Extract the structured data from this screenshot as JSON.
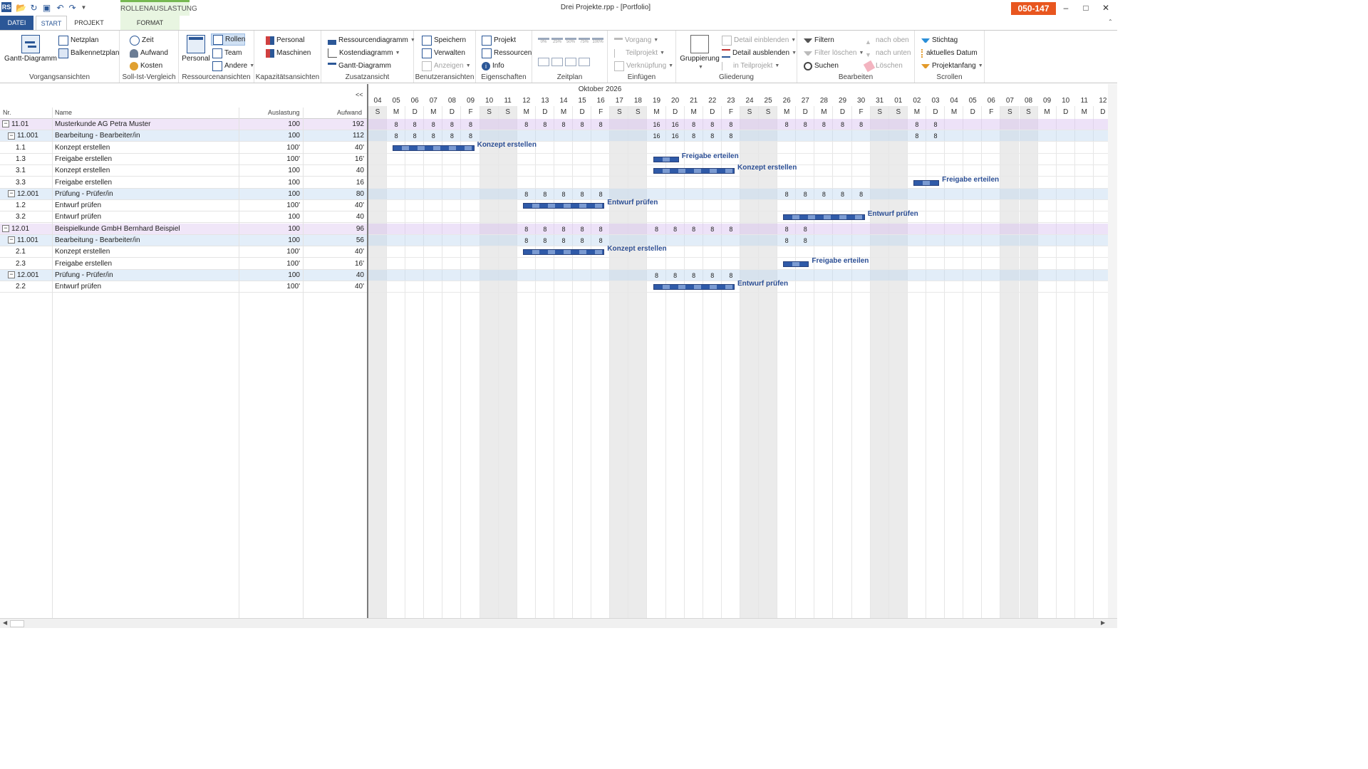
{
  "window": {
    "title": "Drei Projekte.rpp - [Portfolio]",
    "code_badge": "050-147",
    "context_tab_group": "ROLLENAUSLASTUNG",
    "app_logo": "RS"
  },
  "tabs": [
    "DATEI",
    "START",
    "PROJEKT",
    "FORMAT"
  ],
  "ribbon": {
    "vorgangsansichten": {
      "label": "Vorgangsansichten",
      "gantt": "Gantt-Diagramm",
      "netzplan": "Netzplan",
      "balkennetzplan": "Balkennetzplan"
    },
    "sollist": {
      "label": "Soll-Ist-Vergleich",
      "zeit": "Zeit",
      "aufwand": "Aufwand",
      "kosten": "Kosten"
    },
    "ressourcenansichten": {
      "label": "Ressourcenansichten",
      "personal": "Personal",
      "rollen": "Rollen",
      "team": "Team",
      "andere": "Andere"
    },
    "kapazitaet": {
      "label": "Kapazitätsansichten",
      "personal": "Personal",
      "maschinen": "Maschinen"
    },
    "zusatzansicht": {
      "label": "Zusatzansicht",
      "ressourcendiagramm": "Ressourcendiagramm",
      "kostendiagramm": "Kostendiagramm",
      "gantt": "Gantt-Diagramm"
    },
    "benutzeransichten": {
      "label": "Benutzeransichten",
      "speichern": "Speichern",
      "verwalten": "Verwalten",
      "anzeigen": "Anzeigen"
    },
    "eigenschaften": {
      "label": "Eigenschaften",
      "projekt": "Projekt",
      "ressourcen": "Ressourcen",
      "info": "Info"
    },
    "zeitplan": {
      "label": "Zeitplan",
      "percents": [
        "0%",
        "25%",
        "50%",
        "75%",
        "100%"
      ]
    },
    "einfuegen": {
      "label": "Einfügen",
      "vorgang": "Vorgang",
      "teilprojekt": "Teilprojekt",
      "verknuepfung": "Verknüpfung"
    },
    "gliederung": {
      "label": "Gliederung",
      "gruppierung": "Gruppierung",
      "detail_ein": "Detail einblenden",
      "detail_aus": "Detail ausblenden",
      "in_teilprojekt": "in Teilprojekt"
    },
    "bearbeiten": {
      "label": "Bearbeiten",
      "filtern": "Filtern",
      "filter_loeschen": "Filter löschen",
      "suchen": "Suchen",
      "nach_oben": "nach oben",
      "nach_unten": "nach unten",
      "loeschen": "Löschen"
    },
    "scrollen": {
      "label": "Scrollen",
      "stichtag": "Stichtag",
      "aktuelles_datum": "aktuelles Datum",
      "projektanfang": "Projektanfang"
    }
  },
  "table": {
    "collapse_label": "<<",
    "headers": {
      "nr": "Nr.",
      "name": "Name",
      "auslastung": "Auslastung",
      "aufwand": "Aufwand"
    },
    "rows": [
      {
        "level": 0,
        "toggle": "−",
        "nr": "11.01",
        "name": "Musterkunde AG Petra Muster",
        "auslastung": "100",
        "aufwand": "192"
      },
      {
        "level": 1,
        "toggle": "−",
        "nr": "11.001",
        "name": "Bearbeitung - Bearbeiter/in",
        "auslastung": "100",
        "aufwand": "112"
      },
      {
        "level": 2,
        "toggle": "",
        "nr": "1.1",
        "name": "Konzept erstellen",
        "auslastung": "100'",
        "aufwand": "40'"
      },
      {
        "level": 2,
        "toggle": "",
        "nr": "1.3",
        "name": "Freigabe erstellen",
        "auslastung": "100'",
        "aufwand": "16'"
      },
      {
        "level": 2,
        "toggle": "",
        "nr": "3.1",
        "name": "Konzept erstellen",
        "auslastung": "100",
        "aufwand": "40"
      },
      {
        "level": 2,
        "toggle": "",
        "nr": "3.3",
        "name": "Freigabe erstellen",
        "auslastung": "100",
        "aufwand": "16"
      },
      {
        "level": 1,
        "toggle": "−",
        "nr": "12.001",
        "name": "Prüfung - Prüfer/in",
        "auslastung": "100",
        "aufwand": "80"
      },
      {
        "level": 2,
        "toggle": "",
        "nr": "1.2",
        "name": "Entwurf prüfen",
        "auslastung": "100'",
        "aufwand": "40'"
      },
      {
        "level": 2,
        "toggle": "",
        "nr": "3.2",
        "name": "Entwurf prüfen",
        "auslastung": "100",
        "aufwand": "40"
      },
      {
        "level": 0,
        "toggle": "−",
        "nr": "12.01",
        "name": "Beispielkunde GmbH Bernhard Beispiel",
        "auslastung": "100",
        "aufwand": "96"
      },
      {
        "level": 1,
        "toggle": "−",
        "nr": "11.001",
        "name": "Bearbeitung - Bearbeiter/in",
        "auslastung": "100",
        "aufwand": "56"
      },
      {
        "level": 2,
        "toggle": "",
        "nr": "2.1",
        "name": "Konzept erstellen",
        "auslastung": "100'",
        "aufwand": "40'"
      },
      {
        "level": 2,
        "toggle": "",
        "nr": "2.3",
        "name": "Freigabe erstellen",
        "auslastung": "100'",
        "aufwand": "16'"
      },
      {
        "level": 1,
        "toggle": "−",
        "nr": "12.001",
        "name": "Prüfung - Prüfer/in",
        "auslastung": "100",
        "aufwand": "40"
      },
      {
        "level": 2,
        "toggle": "",
        "nr": "2.2",
        "name": "Entwurf prüfen",
        "auslastung": "100'",
        "aufwand": "40'"
      }
    ]
  },
  "gantt": {
    "month": "Oktober 2026",
    "days": [
      {
        "d": "04",
        "w": "S",
        "we": true
      },
      {
        "d": "05",
        "w": "M"
      },
      {
        "d": "06",
        "w": "D"
      },
      {
        "d": "07",
        "w": "M"
      },
      {
        "d": "08",
        "w": "D"
      },
      {
        "d": "09",
        "w": "F"
      },
      {
        "d": "10",
        "w": "S",
        "we": true
      },
      {
        "d": "11",
        "w": "S",
        "we": true
      },
      {
        "d": "12",
        "w": "M"
      },
      {
        "d": "13",
        "w": "D"
      },
      {
        "d": "14",
        "w": "M"
      },
      {
        "d": "15",
        "w": "D"
      },
      {
        "d": "16",
        "w": "F"
      },
      {
        "d": "17",
        "w": "S",
        "we": true
      },
      {
        "d": "18",
        "w": "S",
        "we": true
      },
      {
        "d": "19",
        "w": "M"
      },
      {
        "d": "20",
        "w": "D"
      },
      {
        "d": "21",
        "w": "M"
      },
      {
        "d": "22",
        "w": "D"
      },
      {
        "d": "23",
        "w": "F"
      },
      {
        "d": "24",
        "w": "S",
        "we": true
      },
      {
        "d": "25",
        "w": "S",
        "we": true
      },
      {
        "d": "26",
        "w": "M"
      },
      {
        "d": "27",
        "w": "D"
      },
      {
        "d": "28",
        "w": "M"
      },
      {
        "d": "29",
        "w": "D"
      },
      {
        "d": "30",
        "w": "F"
      },
      {
        "d": "31",
        "w": "S",
        "we": true
      },
      {
        "d": "01",
        "w": "S",
        "we": true
      },
      {
        "d": "02",
        "w": "M"
      },
      {
        "d": "03",
        "w": "D"
      },
      {
        "d": "04",
        "w": "M"
      },
      {
        "d": "05",
        "w": "D"
      },
      {
        "d": "06",
        "w": "F"
      },
      {
        "d": "07",
        "w": "S",
        "we": true
      },
      {
        "d": "08",
        "w": "S",
        "we": true
      },
      {
        "d": "09",
        "w": "M"
      },
      {
        "d": "10",
        "w": "D"
      },
      {
        "d": "11",
        "w": "M"
      },
      {
        "d": "12",
        "w": "D"
      }
    ],
    "row_values": [
      {
        "row": 0,
        "vals": [
          [
            1,
            "8"
          ],
          [
            2,
            "8"
          ],
          [
            3,
            "8"
          ],
          [
            4,
            "8"
          ],
          [
            5,
            "8"
          ],
          [
            8,
            "8"
          ],
          [
            9,
            "8"
          ],
          [
            10,
            "8"
          ],
          [
            11,
            "8"
          ],
          [
            12,
            "8"
          ],
          [
            15,
            "16"
          ],
          [
            16,
            "16"
          ],
          [
            17,
            "8"
          ],
          [
            18,
            "8"
          ],
          [
            19,
            "8"
          ],
          [
            22,
            "8"
          ],
          [
            23,
            "8"
          ],
          [
            24,
            "8"
          ],
          [
            25,
            "8"
          ],
          [
            26,
            "8"
          ],
          [
            29,
            "8"
          ],
          [
            30,
            "8"
          ]
        ]
      },
      {
        "row": 1,
        "vals": [
          [
            1,
            "8"
          ],
          [
            2,
            "8"
          ],
          [
            3,
            "8"
          ],
          [
            4,
            "8"
          ],
          [
            5,
            "8"
          ],
          [
            15,
            "16"
          ],
          [
            16,
            "16"
          ],
          [
            17,
            "8"
          ],
          [
            18,
            "8"
          ],
          [
            19,
            "8"
          ],
          [
            29,
            "8"
          ],
          [
            30,
            "8"
          ]
        ]
      },
      {
        "row": 6,
        "vals": [
          [
            8,
            "8"
          ],
          [
            9,
            "8"
          ],
          [
            10,
            "8"
          ],
          [
            11,
            "8"
          ],
          [
            12,
            "8"
          ],
          [
            22,
            "8"
          ],
          [
            23,
            "8"
          ],
          [
            24,
            "8"
          ],
          [
            25,
            "8"
          ],
          [
            26,
            "8"
          ]
        ]
      },
      {
        "row": 9,
        "vals": [
          [
            8,
            "8"
          ],
          [
            9,
            "8"
          ],
          [
            10,
            "8"
          ],
          [
            11,
            "8"
          ],
          [
            12,
            "8"
          ],
          [
            15,
            "8"
          ],
          [
            16,
            "8"
          ],
          [
            17,
            "8"
          ],
          [
            18,
            "8"
          ],
          [
            19,
            "8"
          ],
          [
            22,
            "8"
          ],
          [
            23,
            "8"
          ]
        ]
      },
      {
        "row": 10,
        "vals": [
          [
            8,
            "8"
          ],
          [
            9,
            "8"
          ],
          [
            10,
            "8"
          ],
          [
            11,
            "8"
          ],
          [
            12,
            "8"
          ],
          [
            22,
            "8"
          ],
          [
            23,
            "8"
          ]
        ]
      },
      {
        "row": 13,
        "vals": [
          [
            15,
            "8"
          ],
          [
            16,
            "8"
          ],
          [
            17,
            "8"
          ],
          [
            18,
            "8"
          ],
          [
            19,
            "8"
          ]
        ]
      }
    ],
    "bars": [
      {
        "row": 2,
        "start": 1,
        "end": 5,
        "label": "Konzept erstellen"
      },
      {
        "row": 3,
        "start": 15,
        "end": 16,
        "label": "Freigabe erteilen"
      },
      {
        "row": 4,
        "start": 15,
        "end": 19,
        "label": "Konzept erstellen"
      },
      {
        "row": 5,
        "start": 29,
        "end": 30,
        "label": "Freigabe erteilen"
      },
      {
        "row": 7,
        "start": 8,
        "end": 12,
        "label": "Entwurf prüfen"
      },
      {
        "row": 8,
        "start": 22,
        "end": 26,
        "label": "Entwurf prüfen"
      },
      {
        "row": 11,
        "start": 8,
        "end": 12,
        "label": "Konzept erstellen"
      },
      {
        "row": 12,
        "start": 22,
        "end": 23,
        "label": "Freigabe erteilen"
      },
      {
        "row": 14,
        "start": 15,
        "end": 19,
        "label": "Entwurf prüfen"
      }
    ]
  },
  "colors": {
    "accent": "#2b5797",
    "badge": "#e8561f",
    "bar": "#2f5aa8",
    "level0": "#f0e6f8",
    "level1": "#e3eef9"
  }
}
